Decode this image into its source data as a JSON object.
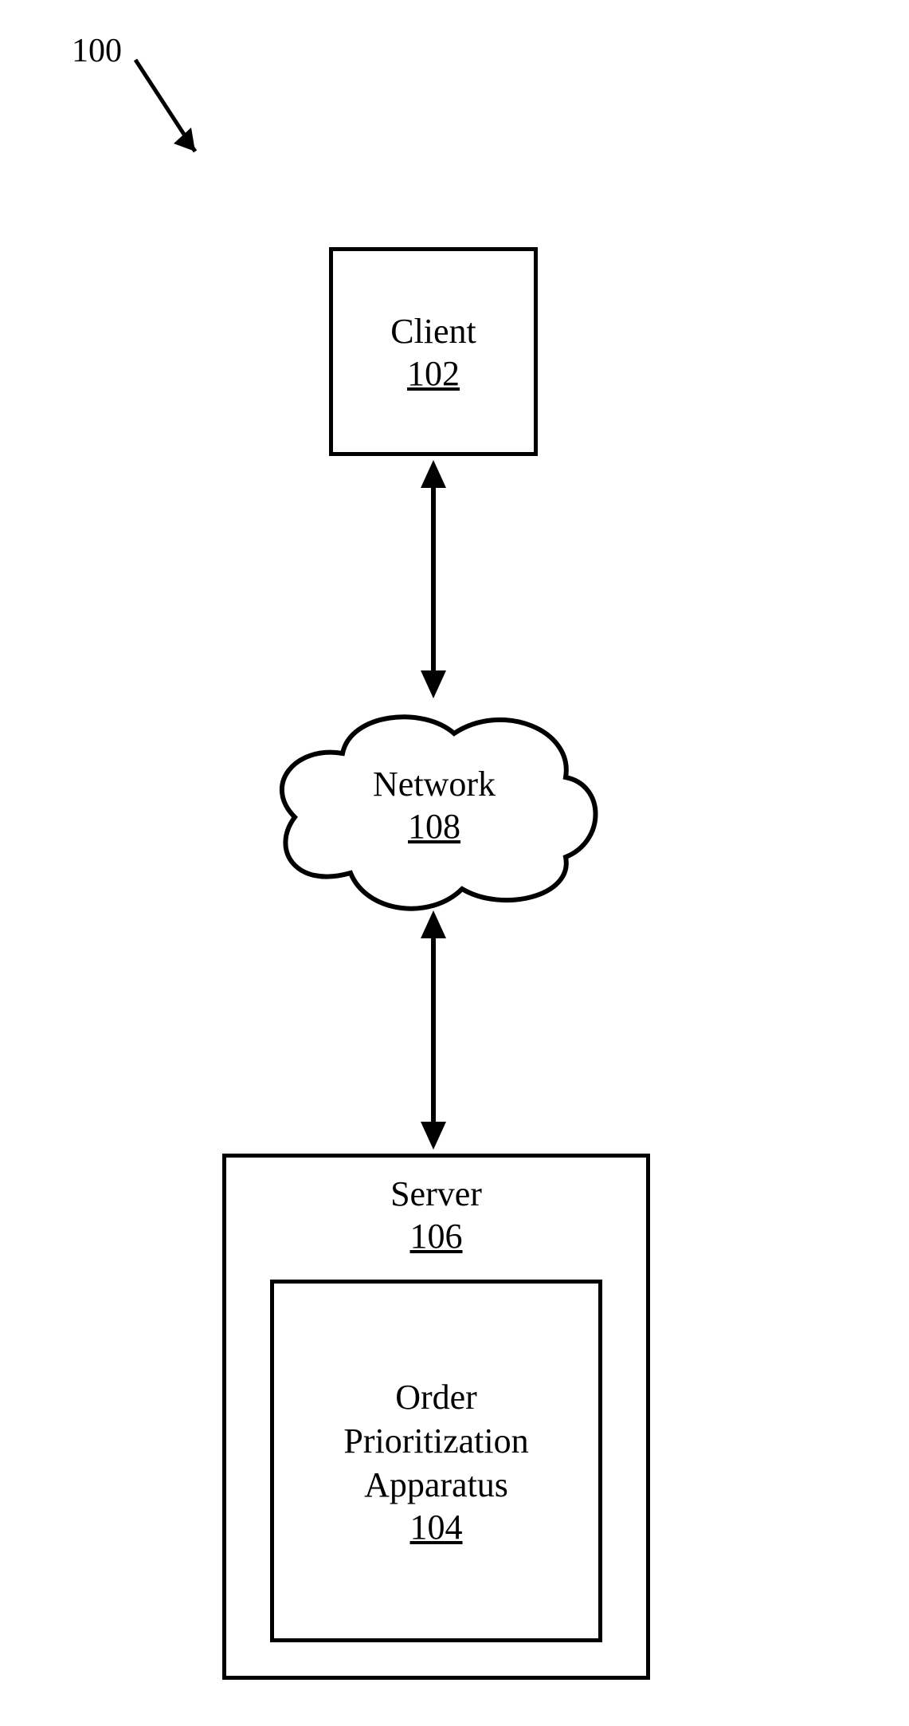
{
  "figure": {
    "ref_label": "100",
    "client": {
      "label": "Client",
      "ref": "102"
    },
    "network": {
      "label": "Network",
      "ref": "108"
    },
    "server": {
      "label": "Server",
      "ref": "106"
    },
    "order_prioritization": {
      "label": "Order\nPrioritization\nApparatus",
      "ref": "104"
    }
  }
}
